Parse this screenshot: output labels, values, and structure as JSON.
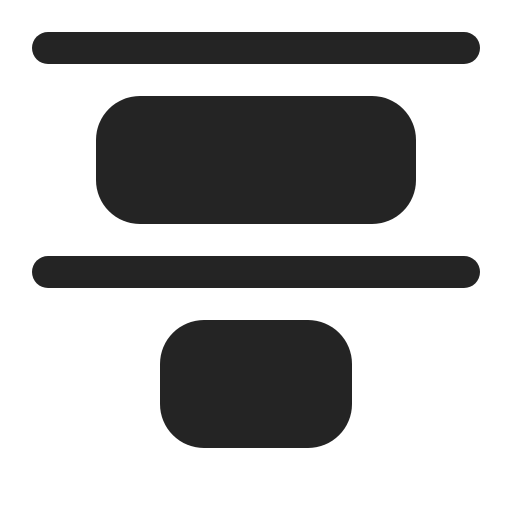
{
  "icon": {
    "name": "align-vertical-distribute-center-icon",
    "color": "#242424",
    "background": "#ffffff"
  }
}
